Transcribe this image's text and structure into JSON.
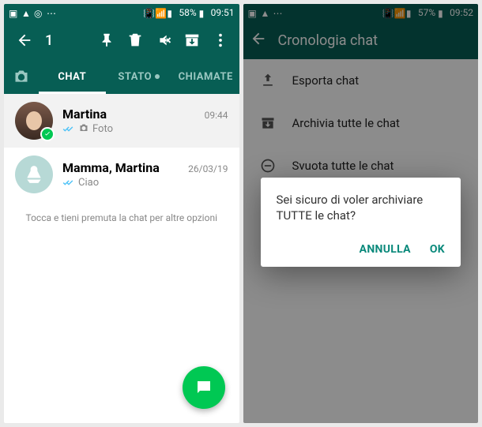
{
  "left": {
    "statusbar": {
      "battery": "58%",
      "time": "09:51"
    },
    "selection_count": "1",
    "tabs": {
      "chat": "CHAT",
      "stato": "STATO",
      "chiamate": "CHIAMATE"
    },
    "chats": [
      {
        "name": "Martina",
        "time": "09:44",
        "subtitle": "Foto",
        "has_photo_icon": true,
        "selected": true
      },
      {
        "name": "Mamma, Martina",
        "time": "26/03/19",
        "subtitle": "Ciao",
        "has_photo_icon": false,
        "selected": false
      }
    ],
    "hint": "Tocca e tieni premuta la chat per altre opzioni"
  },
  "right": {
    "statusbar": {
      "battery": "57%",
      "time": "09:52"
    },
    "header_title": "Cronologia chat",
    "items": {
      "export": "Esporta chat",
      "archive_all": "Archivia tutte le chat",
      "clear_all": "Svuota tutte le chat"
    },
    "dialog": {
      "message": "Sei sicuro di voler archiviare TUTTE le chat?",
      "cancel": "ANNULLA",
      "ok": "OK"
    }
  }
}
